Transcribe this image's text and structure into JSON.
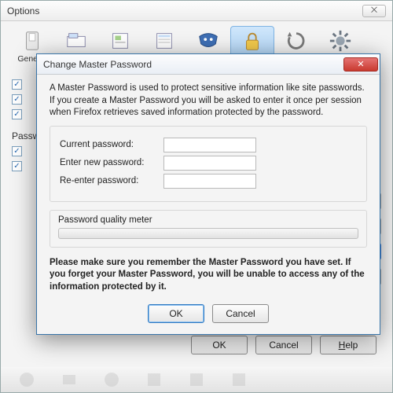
{
  "options_window": {
    "title": "Options",
    "window_close_glyph": "⨉",
    "toolbar": [
      {
        "label": "General",
        "selected": false
      },
      {
        "label": "Tabs",
        "selected": false
      },
      {
        "label": "Content",
        "selected": false
      },
      {
        "label": "Applications",
        "selected": false
      },
      {
        "label": "Privacy",
        "selected": false
      },
      {
        "label": "Security",
        "selected": true
      },
      {
        "label": "Sync",
        "selected": false
      },
      {
        "label": "Advanced",
        "selected": false
      }
    ],
    "checkbox_rows": 3,
    "section_label": "Passwords",
    "pass_checkbox_rows": 2,
    "side_buttons": [
      {
        "text": "...",
        "style": "plain"
      },
      {
        "text": "...",
        "style": "plain"
      },
      {
        "text": "...",
        "style": "blue"
      },
      {
        "text": "...",
        "style": "plain"
      }
    ],
    "footer": {
      "ok": "OK",
      "cancel": "Cancel",
      "help_pre": "H",
      "help_rest": "elp"
    }
  },
  "dialog": {
    "title": "Change Master Password",
    "close_glyph": "✕",
    "description": "A Master Password is used to protect sensitive information like site passwords. If you create a Master Password you will be asked to enter it once per session when Firefox retrieves saved information protected by the password.",
    "fields": {
      "current_label": "Current password:",
      "new_label": "Enter new password:",
      "re_label": "Re-enter password:",
      "current_value": "",
      "new_value": "",
      "re_value": ""
    },
    "meter_label": "Password quality meter",
    "warning": "Please make sure you remember the Master Password you have set. If you forget your Master Password, you will be unable to access any of the information protected by it.",
    "buttons": {
      "ok": "OK",
      "cancel": "Cancel"
    }
  }
}
